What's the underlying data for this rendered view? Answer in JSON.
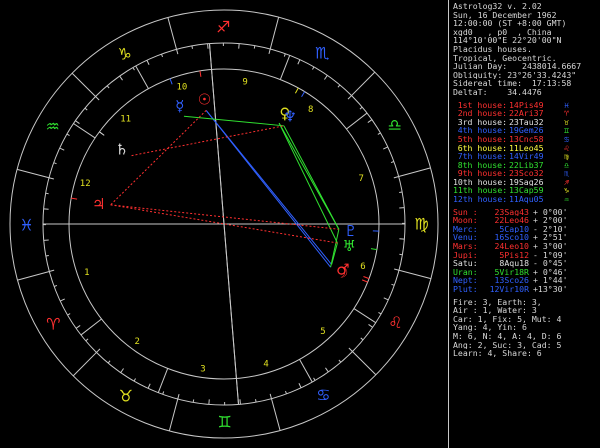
{
  "app": {
    "title": "Astrolog32 v. 2.02"
  },
  "chart_info": [
    "Sun, 16 December 1962",
    "12:00:00 (ST +8:00 GMT)",
    "xgd0   , p0  , China",
    "114°10'00\"E 22°20'00\"N",
    "Placidus houses.",
    "Tropical, Geocentric.",
    "Julian Day:   2438014.6667",
    "Obliquity: 23°26'33.4243\"",
    "Sidereal time:  17:13:58",
    "DeltaT:    34.4476"
  ],
  "houses": [
    {
      "name": "1st house:",
      "value": "14Pis49",
      "color": "#ff3030",
      "sym": "♓",
      "sc": "#3060ff"
    },
    {
      "name": "2nd house:",
      "value": "22Ari37",
      "color": "#ff3030",
      "sym": "♈",
      "sc": "#ff3030"
    },
    {
      "name": "3rd house:",
      "value": "23Tau32",
      "color": "#e0e0e0",
      "sym": "♉",
      "sc": "#e0e020"
    },
    {
      "name": "4th house:",
      "value": "19Gem26",
      "color": "#3060ff",
      "sym": "♊",
      "sc": "#30e030"
    },
    {
      "name": "5th house:",
      "value": "13Cnc58",
      "color": "#ff3030",
      "sym": "♋",
      "sc": "#3060ff"
    },
    {
      "name": "6th house:",
      "value": "11Leo45",
      "color": "#ffff40",
      "sym": "♌",
      "sc": "#ff3030"
    },
    {
      "name": "7th house:",
      "value": "14Vir49",
      "color": "#3060ff",
      "sym": "♍",
      "sc": "#e0e020"
    },
    {
      "name": "8th house:",
      "value": "22Lib37",
      "color": "#30e030",
      "sym": "♎",
      "sc": "#30e030"
    },
    {
      "name": "9th house:",
      "value": "23Sco32",
      "color": "#ff3030",
      "sym": "♏",
      "sc": "#3060ff"
    },
    {
      "name": "10th house:",
      "value": "19Sag26",
      "color": "#e0e0e0",
      "sym": "♐",
      "sc": "#ff3030"
    },
    {
      "name": "11th house:",
      "value": "13Cap59",
      "color": "#30e030",
      "sym": "♑",
      "sc": "#e0e020"
    },
    {
      "name": "12th house:",
      "value": "11Aqu05",
      "color": "#3060ff",
      "sym": "♒",
      "sc": "#30e030"
    }
  ],
  "planets": [
    {
      "name": "Sun :",
      "value": "23Sag43",
      "decl": "+ 0°00'",
      "color": "#ff3030"
    },
    {
      "name": "Moon:",
      "value": "22Leo46",
      "decl": "+ 2°00'",
      "color": "#ff3030"
    },
    {
      "name": "Merc:",
      "value": "5Cap10",
      "decl": "- 2°10'",
      "color": "#3060ff"
    },
    {
      "name": "Venu:",
      "value": "16Sco10",
      "decl": "+ 2°51'",
      "color": "#3060ff"
    },
    {
      "name": "Mars:",
      "value": "24Leo10",
      "decl": "+ 3°00'",
      "color": "#ff3030"
    },
    {
      "name": "Jupi:",
      "value": "5Pis12",
      "decl": "- 1°09'",
      "color": "#ff3030"
    },
    {
      "name": "Satu:",
      "value": "8Aqu18",
      "decl": "- 0°45'",
      "color": "#e0e0e0"
    },
    {
      "name": "Uran:",
      "value": "5Vir18R",
      "decl": "+ 0°46'",
      "color": "#30e030"
    },
    {
      "name": "Nept:",
      "value": "13Sco26",
      "decl": "+ 1°44'",
      "color": "#3060ff"
    },
    {
      "name": "Plut:",
      "value": "12Vir10R",
      "decl": "+13°30'",
      "color": "#3060ff"
    }
  ],
  "stats": [
    "Fire: 3, Earth: 3,",
    "Air : 1, Water: 3",
    "Car: 1, Fix: 5, Mut: 4",
    "Yang: 4, Yin: 6",
    "M: 6, N: 4, A: 4, D: 6",
    "Ang: 2, Suc: 3, Cad: 5",
    "Learn: 4, Share: 6"
  ],
  "wheel": {
    "house_numbers": [
      "1",
      "2",
      "3",
      "4",
      "5",
      "6",
      "7",
      "8",
      "9",
      "10",
      "11",
      "12"
    ],
    "zodiac_glyphs": [
      "♈",
      "♉",
      "♊",
      "♋",
      "♌",
      "♍",
      "♎",
      "♏",
      "♐",
      "♑",
      "♒",
      "♓"
    ],
    "planet_glyphs": [
      "☉",
      "☽",
      "☿",
      "♀",
      "♂",
      "♃",
      "♄",
      "♅",
      "♆",
      "♇"
    ]
  },
  "colors": {
    "red": "#ff3030",
    "blue": "#3060ff",
    "green": "#30e030",
    "yellow": "#e0e020",
    "white": "#e0e0e0",
    "gray": "#c8c8c8"
  }
}
